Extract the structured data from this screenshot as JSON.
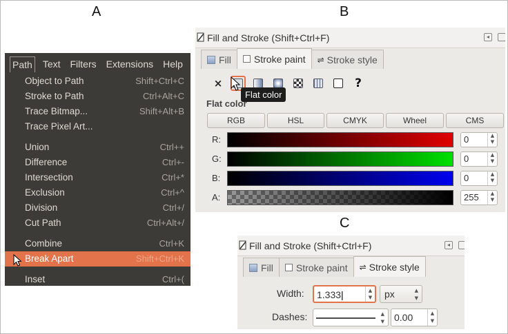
{
  "labels": {
    "a": "A",
    "b": "B",
    "c": "C"
  },
  "panel_a": {
    "menubar": [
      "Path",
      "Text",
      "Filters",
      "Extensions",
      "Help"
    ],
    "groups": [
      [
        {
          "label": "Object to Path",
          "shortcut": "Shift+Ctrl+C"
        },
        {
          "label": "Stroke to Path",
          "shortcut": "Ctrl+Alt+C"
        },
        {
          "label": "Trace Bitmap...",
          "shortcut": "Shift+Alt+B"
        },
        {
          "label": "Trace Pixel Art...",
          "shortcut": ""
        }
      ],
      [
        {
          "label": "Union",
          "shortcut": "Ctrl++"
        },
        {
          "label": "Difference",
          "shortcut": "Ctrl+-"
        },
        {
          "label": "Intersection",
          "shortcut": "Ctrl+*"
        },
        {
          "label": "Exclusion",
          "shortcut": "Ctrl+^"
        },
        {
          "label": "Division",
          "shortcut": "Ctrl+/"
        },
        {
          "label": "Cut Path",
          "shortcut": "Ctrl+Alt+/"
        }
      ],
      [
        {
          "label": "Combine",
          "shortcut": "Ctrl+K"
        },
        {
          "label": "Break Apart",
          "shortcut": "Shift+Ctrl+K",
          "highlighted": true
        }
      ],
      [
        {
          "label": "Inset",
          "shortcut": "Ctrl+("
        }
      ]
    ],
    "highlight_color": "#e2734a"
  },
  "panel_b": {
    "title": "Fill and Stroke (Shift+Ctrl+F)",
    "tabs": {
      "fill": "Fill",
      "stroke_paint": "Stroke paint",
      "stroke_style": "Stroke style"
    },
    "paint_buttons": [
      "none-icon",
      "flat-color-icon",
      "linear-gradient-icon",
      "radial-gradient-icon",
      "pattern-icon",
      "swatch-icon",
      "unset-icon"
    ],
    "tooltip": "Flat color",
    "section_title": "Flat color",
    "modes": [
      "RGB",
      "HSL",
      "CMYK",
      "Wheel",
      "CMS"
    ],
    "channels": [
      {
        "label": "R:",
        "value": "0",
        "color": "#e00000"
      },
      {
        "label": "G:",
        "value": "0",
        "color": "#00e000"
      },
      {
        "label": "B:",
        "value": "0",
        "color": "#0000ee"
      },
      {
        "label": "A:",
        "value": "255",
        "color": "#000000"
      }
    ]
  },
  "panel_c": {
    "title": "Fill and Stroke (Shift+Ctrl+F)",
    "tabs": {
      "fill": "Fill",
      "stroke_paint": "Stroke paint",
      "stroke_style": "Stroke style"
    },
    "width_label": "Width:",
    "width_value": "1.333",
    "unit": "px",
    "dashes_label": "Dashes:",
    "dash_offset": "0.00"
  }
}
